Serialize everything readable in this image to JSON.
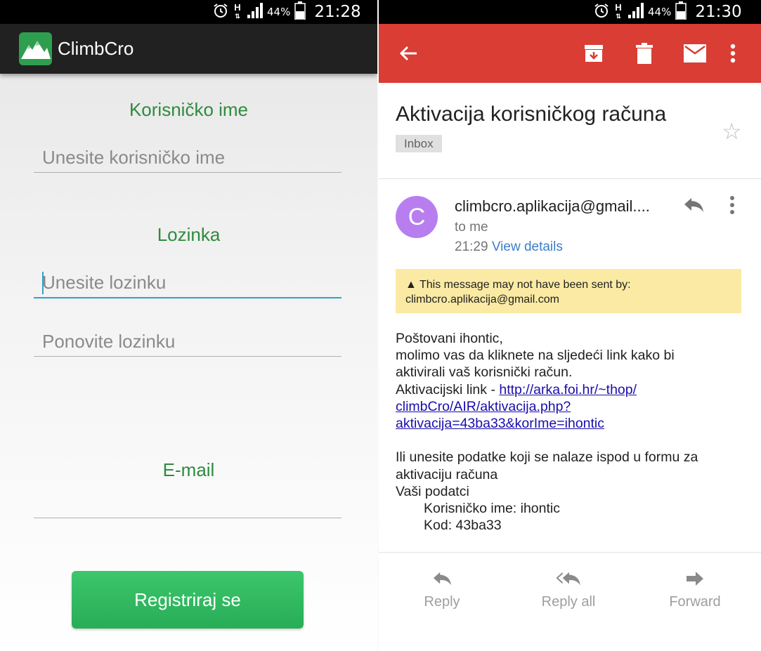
{
  "left": {
    "status_bar": {
      "battery": "44%",
      "time": "21:28",
      "network": "H"
    },
    "app": {
      "title": "ClimbCro"
    },
    "form": {
      "username_label": "Korisničko ime",
      "username_placeholder": "Unesite korisničko ime",
      "password_label": "Lozinka",
      "password_placeholder": "Unesite lozinku",
      "repeat_password_placeholder": "Ponovite lozinku",
      "email_label": "E-mail",
      "email_placeholder": "",
      "register_button": "Registriraj se"
    },
    "colors": {
      "label_green": "#2e8b3e",
      "button_green": "#2eb85c",
      "focus_blue": "#33a0c8"
    }
  },
  "right": {
    "status_bar": {
      "battery": "44%",
      "time": "21:30",
      "network": "H"
    },
    "toolbar": {
      "color": "#d93d34",
      "icons": [
        "back-arrow-icon",
        "archive-icon",
        "delete-icon",
        "mark-unread-icon",
        "more-vert-icon"
      ]
    },
    "email": {
      "subject": "Aktivacija korisničkog računa",
      "label_chip": "Inbox",
      "avatar_letter": "C",
      "sender": "climbcro.aplikacija@gmail....",
      "recipient": "to me",
      "time": "21:29",
      "view_details": "View details",
      "warning_line1": "This message may not have been sent by:",
      "warning_line2": "climbcro.aplikacija@gmail.com",
      "body": {
        "greeting": "Poštovani ihontic,",
        "line1": "molimo vas da kliknete na sljedeći link kako bi",
        "line2": "aktivirali vaš korisnički račun.",
        "link_prefix": "Aktivacijski link - ",
        "link_part1": "http://arka.foi.hr/~thop/",
        "link_part2": "climbCro/AIR/aktivacija.php?",
        "link_part3": "aktivacija=43ba33&korIme=ihontic",
        "line3": "Ili unesite podatke koji se nalaze ispod u formu za",
        "line4": "aktivaciju računa",
        "data_heading": "Vaši podatci",
        "username_line": "Korisničko ime: ihontic",
        "code_line": "Kod: 43ba33"
      }
    },
    "actions": {
      "reply": "Reply",
      "reply_all": "Reply all",
      "forward": "Forward"
    }
  }
}
